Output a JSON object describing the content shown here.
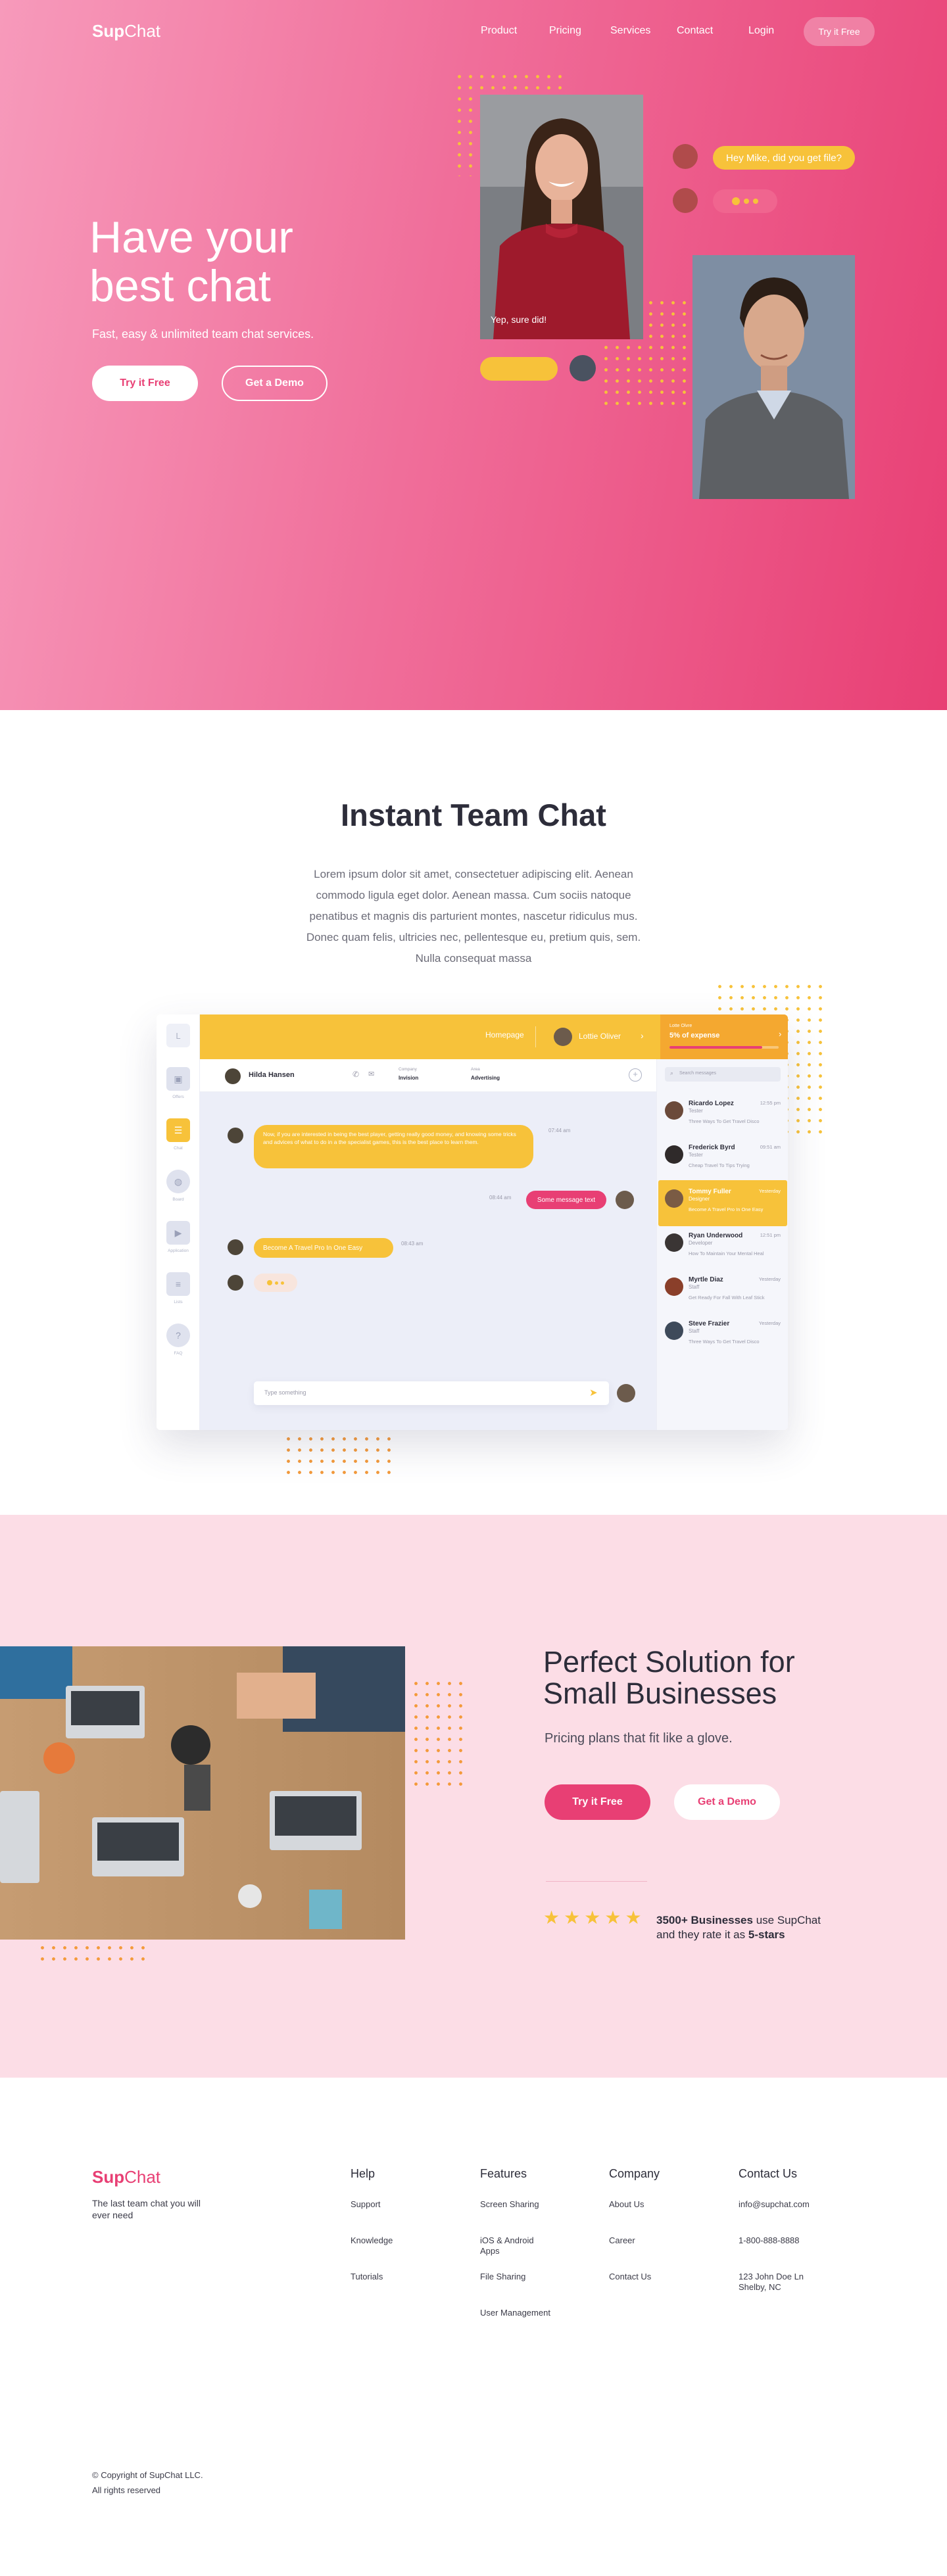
{
  "brand": {
    "name_bold": "Sup",
    "name_light": "Chat",
    "accent": "#e83f74",
    "yellow": "#f7c23a"
  },
  "nav": {
    "items": [
      "Product",
      "Pricing",
      "Services",
      "Contact",
      "Login"
    ],
    "cta": "Try it Free"
  },
  "hero": {
    "title_line1": "Have your",
    "title_line2": "best chat",
    "subtitle": "Fast, easy & unlimited team chat services.",
    "primary_button": "Try it Free",
    "secondary_button": "Get a Demo",
    "bubble_incoming": "Hey Mike, did you get file?",
    "photo_caption": "Yep, sure did!"
  },
  "section2": {
    "title": "Instant Team Chat",
    "body": "Lorem ipsum dolor sit amet, consectetuer adipiscing elit. Aenean commodo ligula eget dolor. Aenean massa. Cum sociis natoque penatibus et magnis dis parturient montes, nascetur ridiculus mus. Donec quam felis, ultricies nec, pellentesque eu, pretium quis, sem. Nulla consequat massa"
  },
  "app": {
    "topbar": {
      "homepage": "Homepage",
      "user": "Lottie Oliver",
      "progress_label": "Lotte Olvre",
      "progress_value": "5% of expense",
      "progress_fraction": 0.85
    },
    "sidebar": [
      {
        "icon": "briefcase-icon",
        "label": "Offers"
      },
      {
        "icon": "chat-icon",
        "label": "Chat",
        "active": true
      },
      {
        "icon": "globe-icon",
        "label": "Board"
      },
      {
        "icon": "video-icon",
        "label": "Application"
      },
      {
        "icon": "list-icon",
        "label": "Lists"
      },
      {
        "icon": "help-icon",
        "label": "FAQ"
      }
    ],
    "chat_header": {
      "name": "Hilda Hansen",
      "field1_label": "Company",
      "field1_value": "Invision",
      "field2_label": "Area",
      "field2_value": "Advertising"
    },
    "messages": [
      {
        "text": "Now, if you are interested in being the best player, getting really good money, and knowing some tricks and advices of what to do in a the specialist games, this is the best place to learn them.",
        "time": "07:44 am",
        "side": "left"
      },
      {
        "text": "Some message text",
        "time": "08:44 am",
        "side": "right"
      },
      {
        "text": "Become A Travel Pro In One Easy",
        "time": "08:43 am",
        "side": "left"
      }
    ],
    "input_placeholder": "Type something",
    "search_placeholder": "Search messages",
    "contacts": [
      {
        "name": "Ricardo Lopez",
        "role": "Tester",
        "time": "12:55 pm",
        "preview": "Three Ways To Get Travel Disco"
      },
      {
        "name": "Frederick Byrd",
        "role": "Tester",
        "time": "09:51 am",
        "preview": "Cheap Travel To Tips Trying"
      },
      {
        "name": "Tommy Fuller",
        "role": "Designer",
        "time": "Yesterday",
        "preview": "Become A Travel Pro In One Easy",
        "active": true
      },
      {
        "name": "Ryan Underwood",
        "role": "Developer",
        "time": "12:51 pm",
        "preview": "How To Maintain Your Mental Heal"
      },
      {
        "name": "Myrtle Diaz",
        "role": "Staff",
        "time": "Yesterday",
        "preview": "Get Ready For Fall With Leaf Stick"
      },
      {
        "name": "Steve Frazier",
        "role": "Staff",
        "time": "Yesterday",
        "preview": "Three Ways To Get Travel Disco"
      }
    ]
  },
  "section3": {
    "title_line1": "Perfect Solution for",
    "title_line2": "Small Businesses",
    "subtitle": "Pricing plans that fit like a glove.",
    "primary_button": "Try it Free",
    "secondary_button": "Get a Demo",
    "rating_stars": 5,
    "rating_strong1": "3500+ Businesses",
    "rating_text1": " use SupChat",
    "rating_text2": "and they rate it as ",
    "rating_strong2": "5-stars"
  },
  "footer": {
    "tagline": "The last team chat you will ever need",
    "columns": [
      {
        "title": "Help",
        "links": [
          "Support",
          "Knowledge",
          "Tutorials"
        ]
      },
      {
        "title": "Features",
        "links": [
          "Screen Sharing",
          "iOS & Android Apps",
          "File Sharing",
          "User Management"
        ]
      },
      {
        "title": "Company",
        "links": [
          "About Us",
          "Career",
          "Contact Us"
        ]
      },
      {
        "title": "Contact Us",
        "links": [
          "info@supchat.com",
          "1-800-888-8888",
          "123 John Doe Ln Shelby, NC"
        ]
      }
    ],
    "copyright": "© Copyright of SupChat LLC.",
    "rights": "All rights reserved"
  }
}
